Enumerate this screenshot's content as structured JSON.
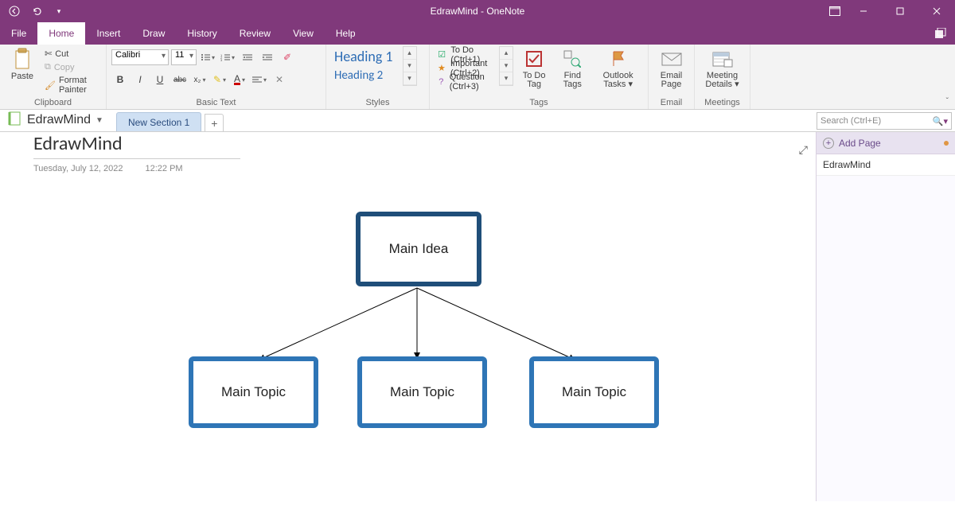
{
  "titlebar": {
    "title": "EdrawMind  -  OneNote"
  },
  "menus": {
    "tabs": [
      "File",
      "Home",
      "Insert",
      "Draw",
      "History",
      "Review",
      "View",
      "Help"
    ],
    "active": "Home"
  },
  "ribbon": {
    "clipboard": {
      "label": "Clipboard",
      "paste": "Paste",
      "cut": "Cut",
      "copy": "Copy",
      "format_painter": "Format Painter"
    },
    "basic_text": {
      "label": "Basic Text",
      "font": "Calibri",
      "size": "11"
    },
    "styles": {
      "label": "Styles",
      "items": [
        "Heading 1",
        "Heading 2"
      ]
    },
    "tags": {
      "label": "Tags",
      "items": [
        {
          "icon": "☑",
          "text": "To Do (Ctrl+1)"
        },
        {
          "icon": "★",
          "text": "Important (Ctrl+2)"
        },
        {
          "icon": "?",
          "text": "Question (Ctrl+3)"
        }
      ],
      "todo": "To Do Tag",
      "find": "Find Tags",
      "outlook": "Outlook Tasks"
    },
    "email": {
      "label": "Email",
      "email_page": "Email Page"
    },
    "meetings": {
      "label": "Meetings",
      "meeting_details": "Meeting Details"
    }
  },
  "notebook": {
    "name": "EdrawMind",
    "section": "New Section 1"
  },
  "search": {
    "placeholder": "Search (Ctrl+E)"
  },
  "page": {
    "title": "EdrawMind",
    "date": "Tuesday, July 12, 2022",
    "time": "12:22 PM"
  },
  "mindmap": {
    "root": "Main Idea",
    "topics": [
      "Main Topic",
      "Main Topic",
      "Main Topic"
    ]
  },
  "right_pane": {
    "add_page": "Add Page",
    "pages": [
      "EdrawMind"
    ]
  }
}
